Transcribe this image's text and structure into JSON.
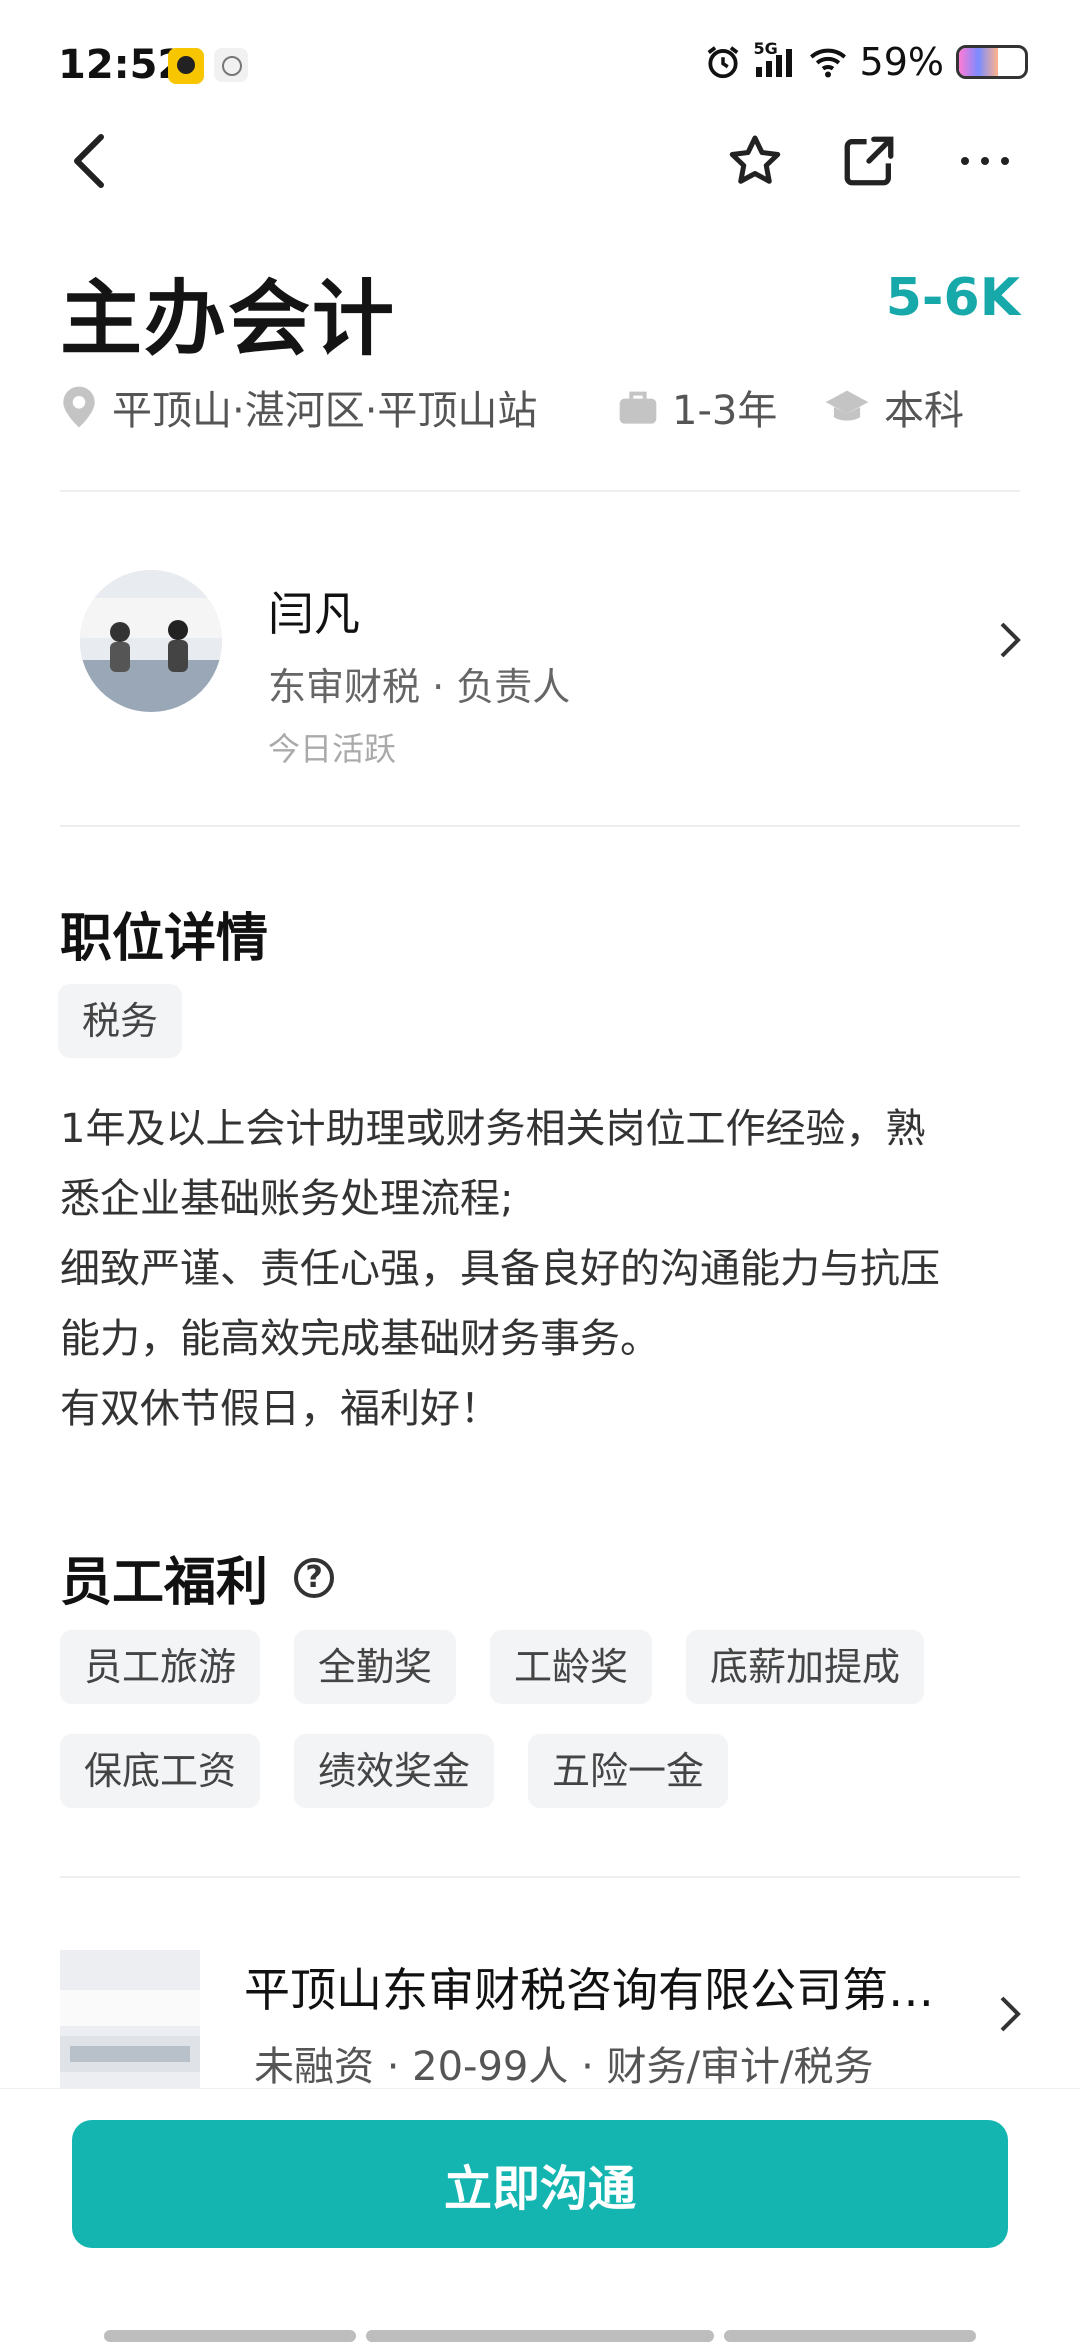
{
  "status_bar": {
    "time": "12:52",
    "network": "5G",
    "battery": "59%",
    "battery_level": 0.59
  },
  "job": {
    "title": "主办会计",
    "salary": "5-6K",
    "location": "平顶山·湛河区·平顶山站",
    "experience": "1-3年",
    "education": "本科"
  },
  "recruiter": {
    "name": "闫凡",
    "company_role": "东审财税 · 负责人",
    "activity": "今日活跃"
  },
  "details": {
    "title": "职位详情",
    "tag": "税务",
    "lines": [
      "1年及以上会计助理或财务相关岗位工作经验，熟",
      "悉企业基础账务处理流程;",
      "细致严谨、责任心强，具备良好的沟通能力与抗压",
      "能力，能高效完成基础财务事务。",
      "有双休节假日，福利好！"
    ]
  },
  "benefits": {
    "title": "员工福利",
    "items": [
      "员工旅游",
      "全勤奖",
      "工龄奖",
      "底薪加提成",
      "保底工资",
      "绩效奖金",
      "五险一金"
    ]
  },
  "company": {
    "name": "平顶山东审财税咨询有限公司第…",
    "info": "未融资 · 20-99人 · 财务/审计/税务"
  },
  "cta": {
    "label": "立即沟通"
  },
  "colors": {
    "accent": "#17a9a9",
    "button": "#14b5b0"
  }
}
